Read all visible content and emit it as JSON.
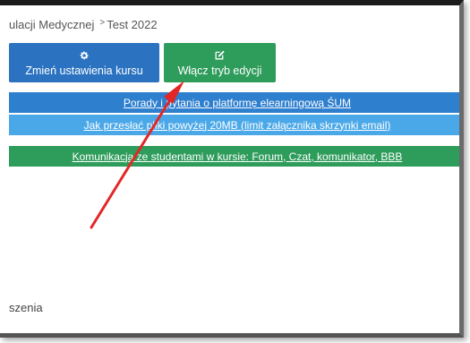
{
  "breadcrumb": {
    "items": [
      "ulacji Medycznej",
      "Test 2022"
    ],
    "separator_icon": "caret-right-icon"
  },
  "toolbar": {
    "settings_button": {
      "label": "Zmień ustawienia kursu",
      "icon": "gear-icon",
      "color": "#2b73c1"
    },
    "edit_button": {
      "label": "Włącz tryb edycji",
      "icon": "edit-icon",
      "color": "#2e9c5b"
    }
  },
  "banners": [
    {
      "text": "Porady i pytania o platformę elearningową ŚUM",
      "color": "#2f7fcf"
    },
    {
      "text": "Jak przesłać pliki powyżej 20MB (limit załącznika skrzynki email)",
      "color": "#4ba8e8"
    },
    {
      "text": "Komunikacja ze studentami w kursie: Forum, Czat, komunikator, BBB",
      "color": "#2e9c5b"
    }
  ],
  "footer": {
    "text": "szenia"
  },
  "annotation": {
    "arrow_color": "#e32626"
  }
}
